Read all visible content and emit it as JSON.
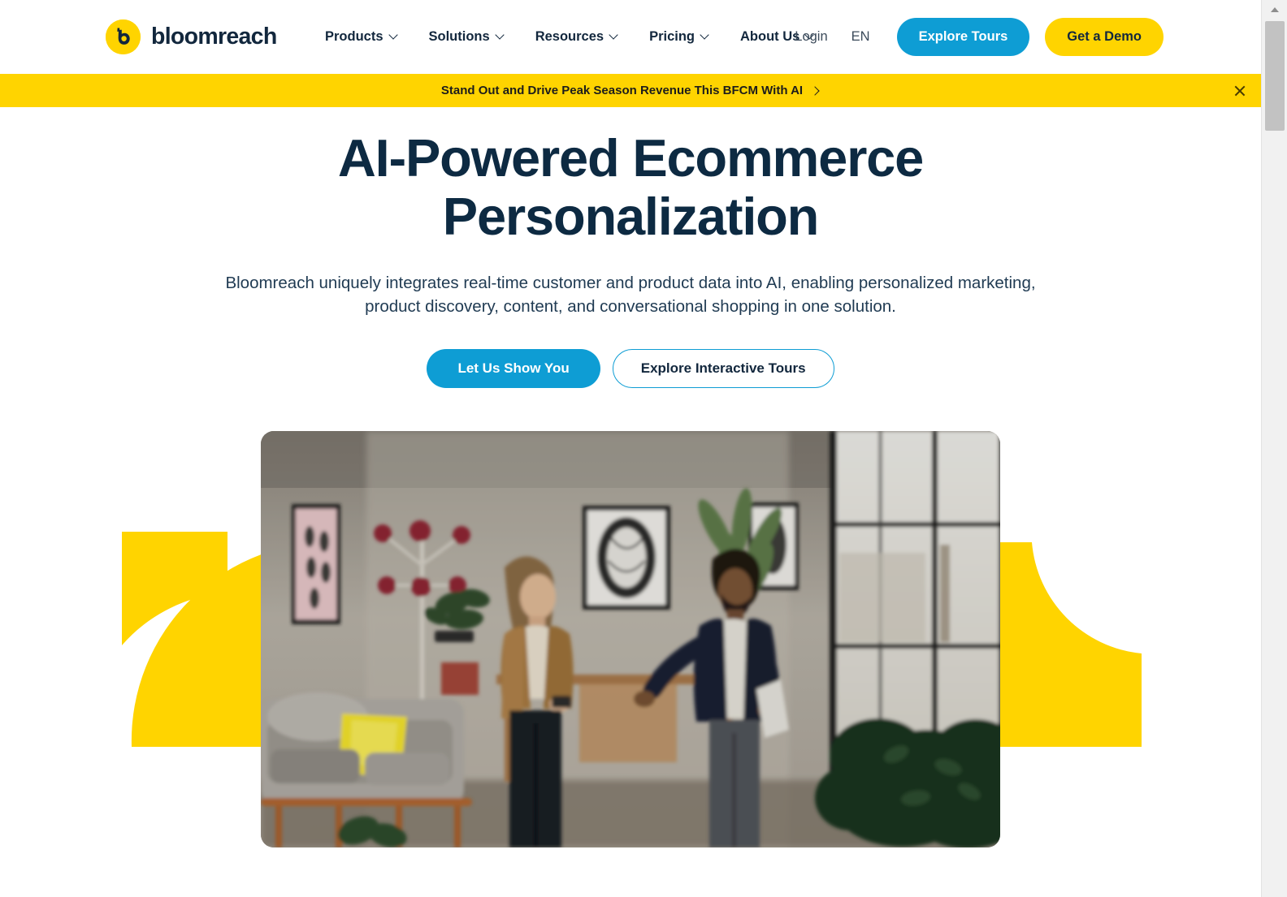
{
  "header": {
    "logo": {
      "mark_icon": "bloomreach-b-icon",
      "text": "bloomreach",
      "mark_color": "#FFD400",
      "text_color": "#12273d"
    },
    "nav": [
      {
        "label": "Products",
        "icon": "chevron-down-icon"
      },
      {
        "label": "Solutions",
        "icon": "chevron-down-icon"
      },
      {
        "label": "Resources",
        "icon": "chevron-down-icon"
      },
      {
        "label": "Pricing",
        "icon": "chevron-down-icon"
      },
      {
        "label": "About Us",
        "icon": "chevron-down-icon"
      }
    ],
    "login_label": "Login",
    "language_label": "EN",
    "explore_tours_label": "Explore Tours",
    "get_demo_label": "Get a Demo",
    "explore_tours_color": "#0e9dd4",
    "get_demo_color": "#FFD400"
  },
  "banner": {
    "text": "Stand Out and Drive Peak Season Revenue This BFCM With AI",
    "arrow_icon": "chevron-right-icon",
    "close_icon": "close-icon",
    "background": "#FFD400"
  },
  "hero": {
    "title": "AI-Powered Ecommerce Personalization",
    "subtitle": "Bloomreach uniquely integrates real-time customer and product data into AI, enabling personalized marketing, product discovery, content, and conversational shopping in one solution.",
    "primary_cta": "Let Us Show You",
    "secondary_cta": "Explore Interactive Tours",
    "title_color": "#0d2a42",
    "primary_cta_color": "#0e9dd4"
  },
  "media": {
    "name": "hero-video",
    "description": "Two people talking in a modern living room office with plants, framed artwork and a grey sofa"
  },
  "decor": {
    "left_shape": "yellow-quarter-arc-shape",
    "right_shape": "yellow-quarter-arc-shape",
    "color": "#FFD400"
  },
  "scrollbar": {
    "up_arrow_icon": "scroll-up-arrow-icon",
    "thumb": "scroll-thumb"
  }
}
